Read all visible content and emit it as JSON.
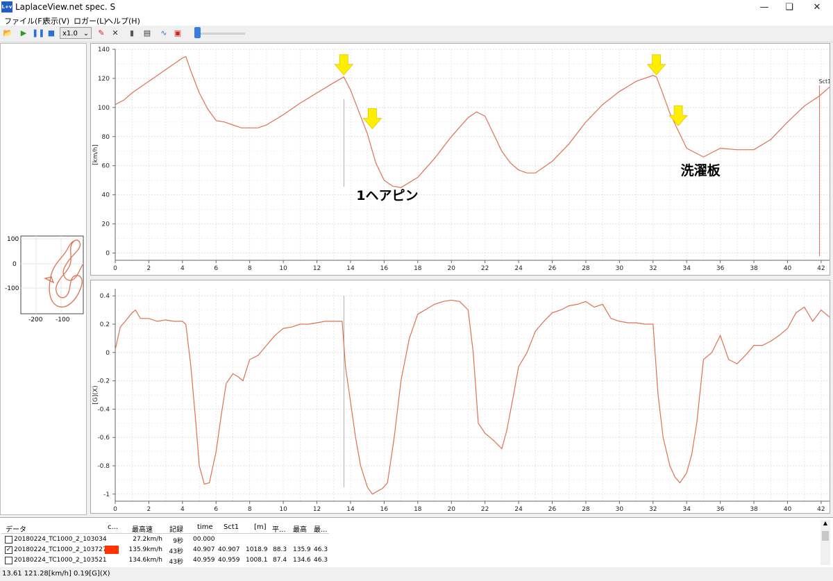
{
  "window": {
    "title": "LaplaceView.net spec. S",
    "icon_label": "L+v"
  },
  "menu": [
    "ファイル(F)",
    "表示(V)",
    "ロガー(L)",
    "ヘルプ(H)"
  ],
  "toolbar": {
    "speed": "x1.0"
  },
  "track_map": {
    "y_ticks": [
      "100",
      "0",
      "-100"
    ],
    "x_ticks": [
      "-200",
      "-100"
    ]
  },
  "chart_data": [
    {
      "type": "line",
      "ylabel": "[km/h]",
      "xlim": [
        0,
        42.5
      ],
      "ylim": [
        -5,
        140
      ],
      "x_ticks": [
        0,
        2,
        4,
        6,
        8,
        10,
        12,
        14,
        16,
        18,
        20,
        22,
        24,
        26,
        28,
        30,
        32,
        34,
        36,
        38,
        40,
        42
      ],
      "y_ticks": [
        0,
        20,
        40,
        60,
        80,
        100,
        120,
        140
      ],
      "cursor_x": 13.61,
      "sector_marker": {
        "label": "Sct1",
        "x": 41.9
      },
      "annotations": [
        {
          "text": "1ヘアピン",
          "x": 15.5,
          "y": 40
        },
        {
          "text": "洗濯板",
          "x": 34.8,
          "y": 57
        }
      ],
      "arrows": [
        {
          "x": 13.6,
          "y": 121
        },
        {
          "x": 15.3,
          "y": 84
        },
        {
          "x": 32.2,
          "y": 121
        },
        {
          "x": 33.5,
          "y": 86
        }
      ],
      "series": [
        {
          "color": "#e07050",
          "x": [
            0,
            0.5,
            1,
            1.5,
            2,
            2.5,
            3,
            3.5,
            4,
            4.2,
            4.5,
            5,
            5.5,
            6,
            6.5,
            7,
            7.5,
            8,
            8.5,
            9,
            10,
            11,
            12,
            13,
            13.6,
            14,
            14.5,
            15,
            15.5,
            16,
            16.5,
            17,
            18,
            19,
            20,
            21,
            21.5,
            22,
            22.5,
            23,
            23.5,
            24,
            24.5,
            25,
            26,
            27,
            28,
            29,
            30,
            31,
            32,
            32.2,
            32.5,
            33,
            33.5,
            34,
            35,
            36,
            37,
            38,
            39,
            40,
            41,
            41.9,
            42.5
          ],
          "y": [
            102,
            105,
            110,
            114,
            118,
            122,
            126,
            130,
            134,
            135,
            125,
            110,
            99,
            91,
            90,
            88,
            86,
            86,
            86,
            88,
            95,
            103,
            110,
            117,
            121,
            112,
            97,
            82,
            62,
            50,
            46,
            45,
            52,
            65,
            80,
            93,
            97,
            94,
            82,
            70,
            62,
            57,
            55,
            55,
            63,
            75,
            90,
            102,
            111,
            118,
            122,
            121,
            112,
            96,
            84,
            72,
            66,
            72,
            71,
            71,
            78,
            90,
            101,
            108,
            114
          ]
        }
      ]
    },
    {
      "type": "line",
      "ylabel": "[G](X)",
      "xlim": [
        0,
        42.5
      ],
      "ylim": [
        -1.05,
        0.45
      ],
      "x_ticks": [
        0,
        2,
        4,
        6,
        8,
        10,
        12,
        14,
        16,
        18,
        20,
        22,
        24,
        26,
        28,
        30,
        32,
        34,
        36,
        38,
        40,
        42
      ],
      "y_ticks": [
        -1,
        -0.8,
        -0.6,
        -0.4,
        -0.2,
        0,
        0.2,
        0.4
      ],
      "cursor_x": 13.61,
      "series": [
        {
          "color": "#e07050",
          "x": [
            0,
            0.3,
            0.6,
            1,
            1.2,
            1.5,
            2,
            2.5,
            3,
            3.5,
            4,
            4.2,
            4.5,
            4.8,
            5,
            5.3,
            5.6,
            6,
            6.3,
            6.6,
            7,
            7.3,
            7.6,
            8,
            8.5,
            9,
            9.5,
            10,
            10.5,
            11,
            11.5,
            12,
            12.5,
            13,
            13.5,
            13.7,
            14,
            14.3,
            14.6,
            15,
            15.3,
            15.6,
            15.9,
            16.2,
            16.6,
            17,
            17.5,
            18,
            19,
            19.5,
            20,
            20.5,
            21,
            21.3,
            21.6,
            22,
            22.5,
            23,
            23.3,
            23.7,
            24,
            24.5,
            25,
            25.5,
            26,
            26.5,
            27,
            27.5,
            28,
            28.5,
            29,
            29.5,
            30,
            30.5,
            31,
            31.5,
            32,
            32.3,
            32.6,
            33,
            33.3,
            33.6,
            34,
            34.3,
            34.6,
            35,
            35.5,
            36,
            36.5,
            37,
            37.5,
            38,
            38.5,
            39,
            39.5,
            40,
            40.5,
            41,
            41.5,
            42,
            42.5
          ],
          "y": [
            0.02,
            0.18,
            0.22,
            0.28,
            0.3,
            0.24,
            0.24,
            0.22,
            0.23,
            0.22,
            0.22,
            0.2,
            -0.1,
            -0.5,
            -0.8,
            -0.93,
            -0.92,
            -0.7,
            -0.45,
            -0.22,
            -0.15,
            -0.17,
            -0.2,
            -0.05,
            -0.02,
            0.05,
            0.12,
            0.17,
            0.18,
            0.2,
            0.2,
            0.21,
            0.22,
            0.22,
            0.22,
            -0.1,
            -0.35,
            -0.6,
            -0.8,
            -0.95,
            -1.0,
            -0.98,
            -0.96,
            -0.92,
            -0.6,
            -0.2,
            0.1,
            0.27,
            0.34,
            0.36,
            0.37,
            0.36,
            0.3,
            0.0,
            -0.5,
            -0.57,
            -0.62,
            -0.68,
            -0.55,
            -0.3,
            -0.1,
            0.0,
            0.15,
            0.22,
            0.28,
            0.3,
            0.33,
            0.34,
            0.36,
            0.32,
            0.34,
            0.24,
            0.22,
            0.21,
            0.21,
            0.2,
            0.2,
            -0.3,
            -0.6,
            -0.8,
            -0.88,
            -0.92,
            -0.85,
            -0.72,
            -0.5,
            -0.05,
            0.0,
            0.12,
            -0.05,
            -0.08,
            -0.02,
            0.05,
            0.05,
            0.08,
            0.12,
            0.17,
            0.28,
            0.32,
            0.22,
            0.3,
            0.25
          ]
        }
      ]
    }
  ],
  "table": {
    "headers": [
      "データ",
      "c...",
      "最高速",
      "記録",
      "time",
      "Sct1",
      "[m]",
      "平...",
      "最高",
      "最..."
    ],
    "rows": [
      {
        "checked": false,
        "name": "20180224_TC1000_2_103034",
        "color": "",
        "max_speed": "27.2km/h",
        "record": "9秒",
        "time": "00.000",
        "sct1": "",
        "m": "",
        "avg": "",
        "max": "",
        "min": ""
      },
      {
        "checked": true,
        "name": "20180224_TC1000_2_103727",
        "color": "#ff3300",
        "max_speed": "135.9km/h",
        "record": "43秒",
        "time": "40.907",
        "sct1": "40.907",
        "m": "1018.9",
        "avg": "88.3",
        "max": "135.9",
        "min": "46.3"
      },
      {
        "checked": false,
        "name": "20180224_TC1000_2_103521",
        "color": "",
        "max_speed": "134.6km/h",
        "record": "43秒",
        "time": "40.959",
        "sct1": "40.959",
        "m": "1008.1",
        "avg": "87.4",
        "max": "134.6",
        "min": "46.3"
      }
    ]
  },
  "status": "13.61  121.28[km/h]  0.19[G](X)"
}
